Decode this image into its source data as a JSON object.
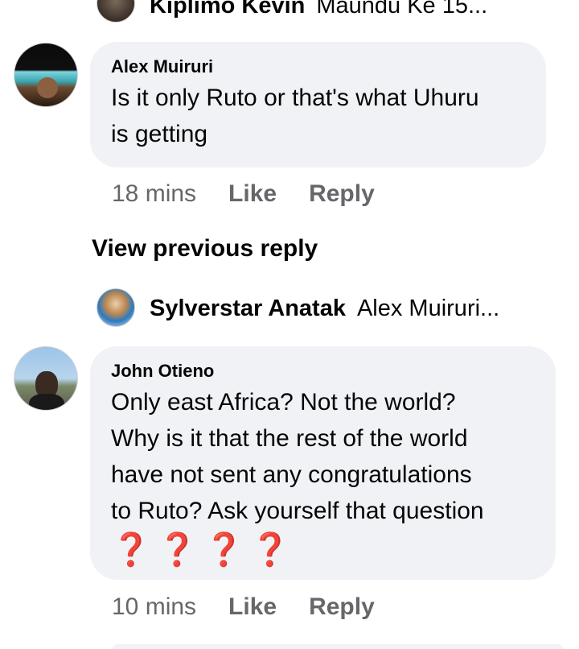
{
  "thread": {
    "top_reply": {
      "name": "Kiplimo Kevin",
      "snippet": "Maundu Ke  15..."
    },
    "comments": [
      {
        "author": "Alex Muiruri",
        "lines": [
          "Is it only Ruto or that's what Uhuru",
          "is getting"
        ],
        "time": "18 mins",
        "like": "Like",
        "reply": "Reply"
      },
      {
        "author": "John Otieno",
        "lines": [
          "Only east Africa? Not the world?",
          "Why is it that the rest of the world",
          "have not sent any congratulations",
          "to Ruto? Ask yourself that question"
        ],
        "emoji": "❓❓❓❓",
        "time": "10 mins",
        "like": "Like",
        "reply": "Reply"
      }
    ],
    "view_previous": "View previous reply",
    "mid_reply": {
      "name": "Sylverstar Anatak",
      "snippet": "Alex Muiruri..."
    }
  },
  "colors": {
    "bubble_bg": "#f0f2f5",
    "meta_text": "#65676b",
    "emoji_red": "#e0245e"
  }
}
